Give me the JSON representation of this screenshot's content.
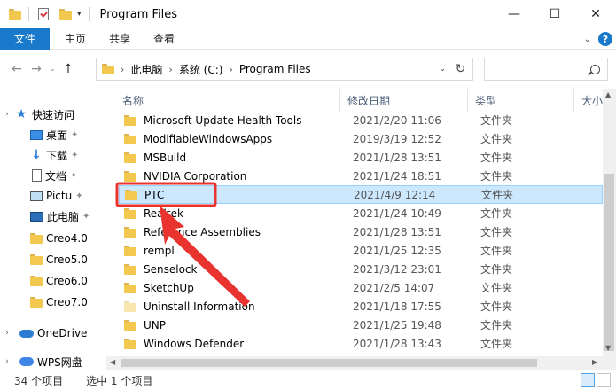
{
  "window": {
    "title": "Program Files",
    "minimize": "—",
    "maximize": "☐",
    "close": "✕"
  },
  "ribbon": {
    "tabs": [
      "文件",
      "主页",
      "共享",
      "查看"
    ],
    "help": "?"
  },
  "navbar": {
    "back": "←",
    "forward": "→",
    "recent": "⌄",
    "up": "↑",
    "breadcrumbs": [
      "此电脑",
      "系统 (C:)",
      "Program Files"
    ],
    "refresh": "↻"
  },
  "navpane": {
    "items": [
      {
        "label": "快速访问",
        "icon": "star-icon",
        "pinned": false,
        "expander": "›"
      },
      {
        "label": "桌面",
        "icon": "desktop-icon",
        "pinned": true
      },
      {
        "label": "下载",
        "icon": "download-icon",
        "pinned": true
      },
      {
        "label": "文档",
        "icon": "document-icon",
        "pinned": true
      },
      {
        "label": "Pictu",
        "icon": "pictures-icon",
        "pinned": true
      },
      {
        "label": "此电脑",
        "icon": "computer-icon",
        "pinned": true
      },
      {
        "label": "Creo4.0",
        "icon": "folder-icon",
        "pinned": false
      },
      {
        "label": "Creo5.0",
        "icon": "folder-icon",
        "pinned": false
      },
      {
        "label": "Creo6.0",
        "icon": "folder-icon",
        "pinned": false
      },
      {
        "label": "Creo7.0",
        "icon": "folder-icon",
        "pinned": false
      },
      {
        "label": "OneDrive",
        "icon": "onedrive-icon",
        "pinned": false,
        "expander": "›"
      },
      {
        "label": "WPS网盘",
        "icon": "wps-cloud-icon",
        "pinned": false,
        "expander": "›"
      }
    ]
  },
  "filelist": {
    "columns": {
      "name": "名称",
      "date": "修改日期",
      "type": "类型",
      "size": "大小"
    },
    "rows": [
      {
        "name": "Microsoft Update Health Tools",
        "date": "2021/2/20 11:06",
        "type": "文件夹"
      },
      {
        "name": "ModifiableWindowsApps",
        "date": "2019/3/19 12:52",
        "type": "文件夹"
      },
      {
        "name": "MSBuild",
        "date": "2021/1/28 13:51",
        "type": "文件夹"
      },
      {
        "name": "NVIDIA Corporation",
        "date": "2021/1/24 18:51",
        "type": "文件夹"
      },
      {
        "name": "PTC",
        "date": "2021/4/9 12:14",
        "type": "文件夹",
        "selected": true
      },
      {
        "name": "Realtek",
        "date": "2021/1/24 10:49",
        "type": "文件夹"
      },
      {
        "name": "Reference Assemblies",
        "date": "2021/1/28 13:51",
        "type": "文件夹"
      },
      {
        "name": "rempl",
        "date": "2021/1/25 12:35",
        "type": "文件夹"
      },
      {
        "name": "Senselock",
        "date": "2021/3/12 23:01",
        "type": "文件夹"
      },
      {
        "name": "SketchUp",
        "date": "2021/2/5 14:07",
        "type": "文件夹"
      },
      {
        "name": "Uninstall Information",
        "date": "2021/1/18 17:55",
        "type": "文件夹"
      },
      {
        "name": "UNP",
        "date": "2021/1/25 19:48",
        "type": "文件夹"
      },
      {
        "name": "Windows Defender",
        "date": "2021/1/28 13:43",
        "type": "文件夹"
      }
    ]
  },
  "status": {
    "count": "34 个项目",
    "selection": "选中 1 个项目"
  },
  "colors": {
    "accent": "#1979ca",
    "selection": "#cce8ff",
    "annotation": "#e8332e",
    "folder": "#f3c84e"
  }
}
